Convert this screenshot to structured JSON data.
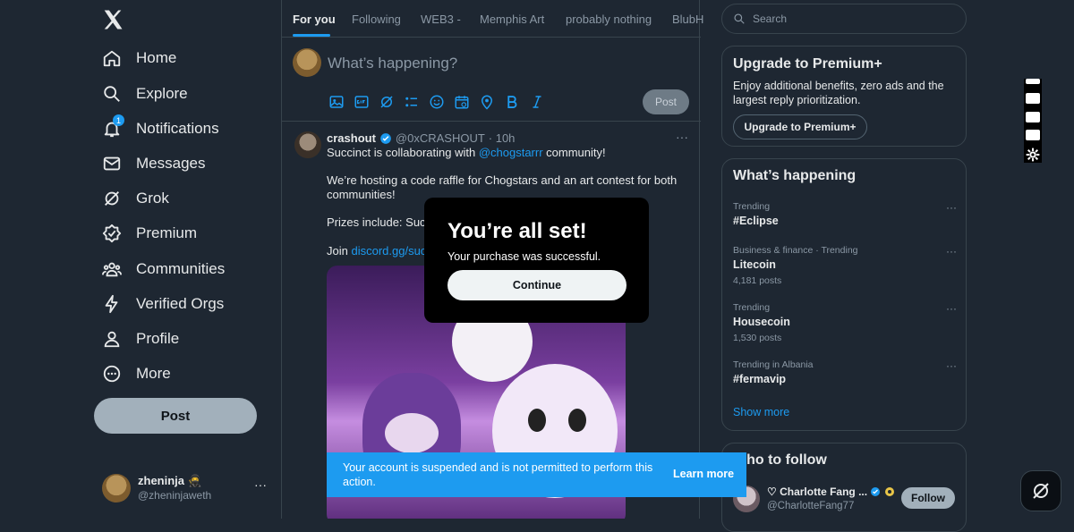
{
  "left_nav": {
    "items": [
      {
        "label": "Home",
        "icon": "home-icon"
      },
      {
        "label": "Explore",
        "icon": "search-icon"
      },
      {
        "label": "Notifications",
        "icon": "bell-icon",
        "badge": "1"
      },
      {
        "label": "Messages",
        "icon": "mail-icon"
      },
      {
        "label": "Grok",
        "icon": "grok-icon"
      },
      {
        "label": "Premium",
        "icon": "premium-icon"
      },
      {
        "label": "Communities",
        "icon": "communities-icon"
      },
      {
        "label": "Verified Orgs",
        "icon": "lightning-icon"
      },
      {
        "label": "Profile",
        "icon": "profile-icon"
      },
      {
        "label": "More",
        "icon": "more-circle-icon"
      }
    ],
    "post_label": "Post",
    "account": {
      "name": "zheninja 🥷",
      "handle": "@zheninjaweth",
      "more": "···"
    }
  },
  "feed": {
    "tabs": [
      "For you",
      "Following",
      "WEB3 -",
      "Memphis Art",
      "probably nothing",
      "BlubH"
    ],
    "composer": {
      "placeholder": "What’s happening?",
      "post_label": "Post"
    },
    "tweet": {
      "author": "crashout",
      "handle": "@0xCRASHOUT",
      "time": "· 10h",
      "more": "···",
      "line1_pre": "Succinct is collaborating with",
      "line1_mention": "@chogstarrr",
      "line1_post": "community!",
      "para2": "We’re hosting a code raffle for Chogstars and an art contest for both communities!",
      "para3": "Prizes include: Succi",
      "para4_pre": "Join",
      "para4_link": "discord.gg/succ"
    }
  },
  "sidebar": {
    "search_placeholder": "Search",
    "premium": {
      "title": "Upgrade to Premium+",
      "desc": "Enjoy additional benefits, zero ads and the largest reply prioritization.",
      "button": "Upgrade to Premium+"
    },
    "happening": {
      "title": "What’s happening",
      "trends": [
        {
          "category": "Trending",
          "name": "#Eclipse",
          "posts": ""
        },
        {
          "category": "Business & finance · Trending",
          "name": "Litecoin",
          "posts": "4,181 posts"
        },
        {
          "category": "Trending",
          "name": "Housecoin",
          "posts": "1,530 posts"
        },
        {
          "category": "Trending in Albania",
          "name": "#fermavip",
          "posts": ""
        }
      ],
      "show_more": "Show more"
    },
    "who_to_follow": {
      "title": "Who to follow",
      "users": [
        {
          "name": "♡ Charlotte Fang ...",
          "handle": "@CharlotteFang77",
          "button": "Follow"
        }
      ]
    }
  },
  "modal": {
    "title": "You’re all set!",
    "subtitle": "Your purchase was successful.",
    "button": "Continue"
  },
  "toast": {
    "message": "Your account is suspended and is not permitted to perform this action.",
    "link": "Learn more"
  },
  "colors": {
    "background": "#1e2732",
    "accent": "#1d9bf0",
    "border": "#38444d"
  }
}
